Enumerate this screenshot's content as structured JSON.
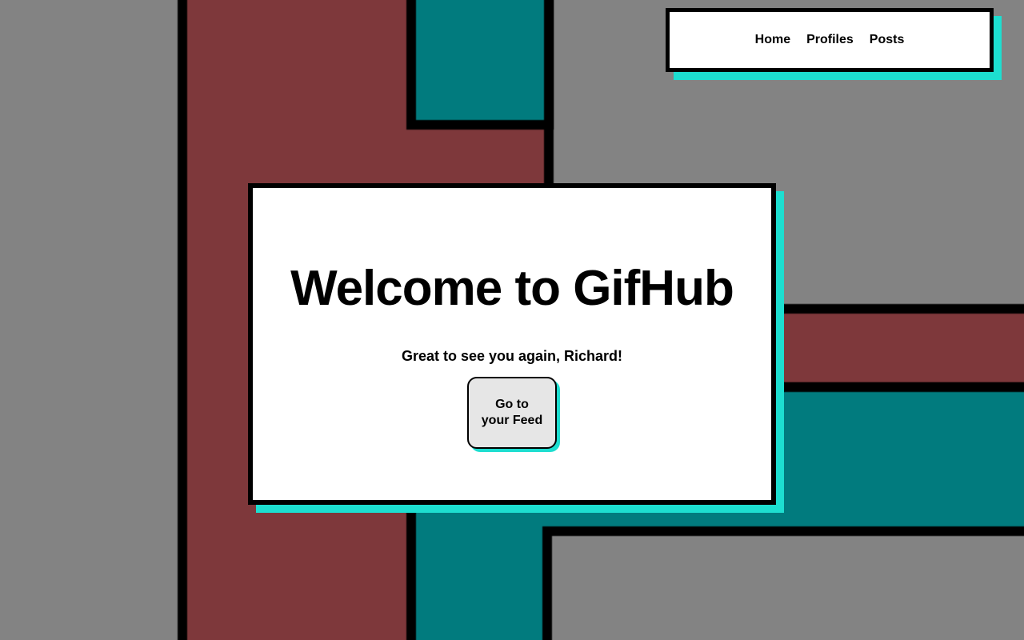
{
  "nav": {
    "items": [
      {
        "label": "Home"
      },
      {
        "label": "Profiles"
      },
      {
        "label": "Posts"
      }
    ]
  },
  "hero": {
    "title": "Welcome to GifHub",
    "greeting": "Great to see you again, Richard!",
    "cta_label": "Go to your Feed"
  },
  "colors": {
    "background": "#838383",
    "accent_shadow": "#1dded0",
    "maroon": "#7e383b",
    "teal": "#017b7e",
    "button_bg": "#e6e6e6"
  }
}
